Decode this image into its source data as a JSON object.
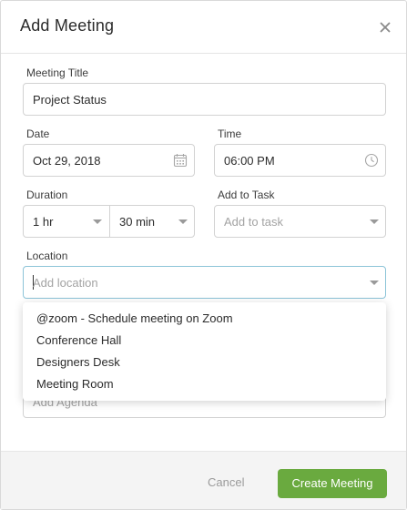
{
  "dialog": {
    "title": "Add Meeting"
  },
  "meeting_title": {
    "label": "Meeting Title",
    "value": "Project Status"
  },
  "date": {
    "label": "Date",
    "value": "Oct 29, 2018"
  },
  "time": {
    "label": "Time",
    "value": "06:00 PM"
  },
  "duration": {
    "label": "Duration",
    "hours": "1 hr",
    "minutes": "30 min"
  },
  "task": {
    "label": "Add to Task",
    "placeholder": "Add to task"
  },
  "location": {
    "label": "Location",
    "placeholder": "Add location",
    "options": [
      "@zoom - Schedule meeting on Zoom",
      "Conference Hall",
      "Designers Desk",
      "Meeting Room"
    ]
  },
  "agenda": {
    "placeholder": "Add Agenda"
  },
  "footer": {
    "cancel_label": "Cancel",
    "create_label": "Create Meeting"
  },
  "colors": {
    "primary_button": "#6aaa3f",
    "focus_border": "#8cc4d8"
  }
}
